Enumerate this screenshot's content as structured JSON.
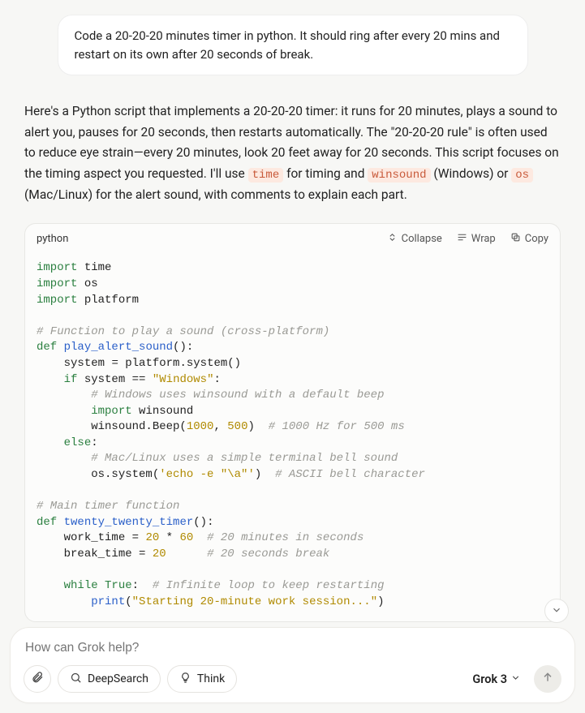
{
  "user_message": "Code a 20-20-20 minutes timer in python. It should ring after every 20 mins and restart on its own after 20 seconds of break.",
  "intro": {
    "part1": "Here's a Python script that implements a 20-20-20 timer: it runs for 20 minutes, plays a sound to alert you, pauses for 20 seconds, then restarts automatically. The \"20-20-20 rule\" is often used to reduce eye strain—every 20 minutes, look 20 feet away for 20 seconds. This script focuses on the timing aspect you requested. I'll use ",
    "code1": "time",
    "part2": " for timing and ",
    "code2": "winsound",
    "part3": " (Windows) or ",
    "code3": "os",
    "part4": " (Mac/Linux) for the alert sound, with comments to explain each part."
  },
  "code_block": {
    "language": "python",
    "actions": {
      "collapse": "Collapse",
      "wrap": "Wrap",
      "copy": "Copy"
    }
  },
  "composer": {
    "placeholder": "How can Grok help?",
    "deepsearch": "DeepSearch",
    "think": "Think",
    "model": "Grok 3"
  },
  "chart_data": null,
  "code_tokens": {
    "import": "import",
    "time_mod": "time",
    "os_mod": "os",
    "platform_mod": "platform",
    "comment_play": "# Function to play a sound (cross-platform)",
    "def": "def",
    "play_alert_sound": "play_alert_sound",
    "system_var": "system",
    "platform_call": "platform.system()",
    "if": "if",
    "eq": " == ",
    "windows_str": "\"Windows\"",
    "comment_win": "# Windows uses winsound with a default beep",
    "winsound_mod": "winsound",
    "winsound_beep": "winsound.Beep(",
    "n1000": "1000",
    "n500": "500",
    "comment_hz": "# 1000 Hz for 500 ms",
    "else": "else",
    "comment_mac": "# Mac/Linux uses a simple terminal bell sound",
    "os_system": "os.system(",
    "echo_str": "'echo -e \"\\a\"'",
    "comment_bell": "# ASCII bell character",
    "comment_main": "# Main timer function",
    "twenty_fn": "twenty_twenty_timer",
    "work_time": "work_time",
    "n20": "20",
    "n60": "60",
    "comment_20min": "# 20 minutes in seconds",
    "break_time": "break_time",
    "comment_20sec": "# 20 seconds break",
    "while": "while",
    "true": "True",
    "comment_loop": "# Infinite loop to keep restarting",
    "print": "print",
    "start_str": "\"Starting 20-minute work session...\""
  }
}
